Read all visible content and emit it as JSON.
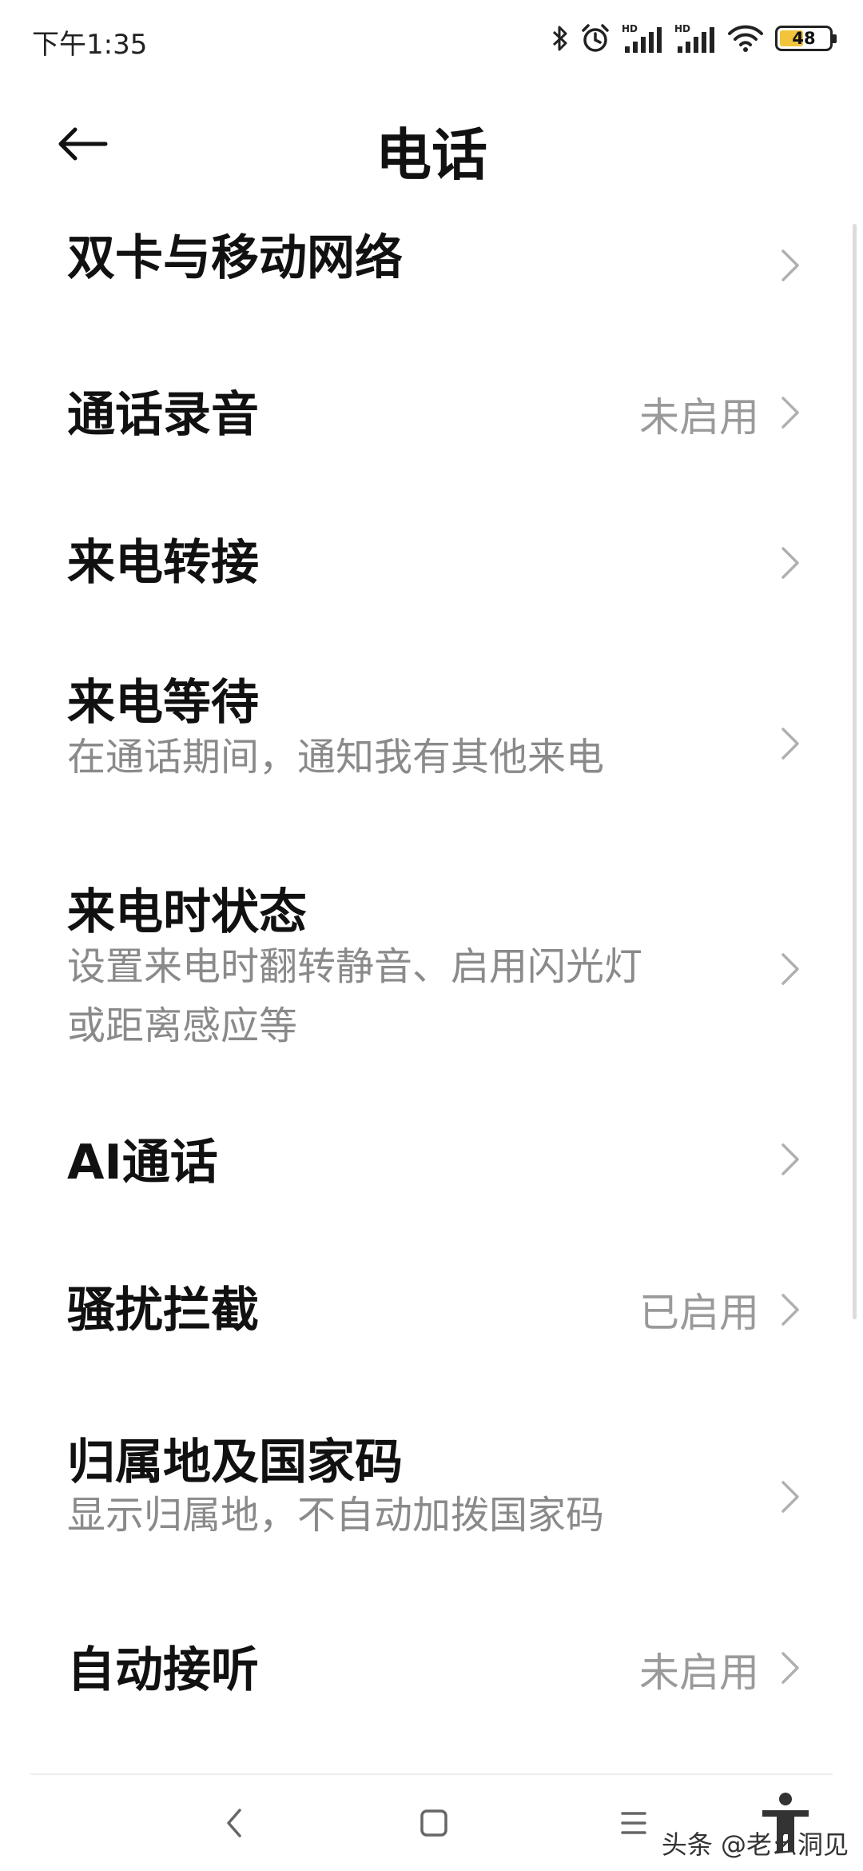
{
  "status_bar": {
    "time": "下午1:35",
    "battery_level": "48",
    "icons": [
      "bluetooth-icon",
      "alarm-icon",
      "hd-signal-icon",
      "hd-signal-icon",
      "wifi-icon",
      "battery-icon"
    ]
  },
  "header": {
    "title": "电话",
    "back_icon": "arrow-left-icon"
  },
  "settings": [
    {
      "title": "双卡与移动网络",
      "subtitle": "",
      "value": ""
    },
    {
      "title": "通话录音",
      "subtitle": "",
      "value": "未启用"
    },
    {
      "title": "来电转接",
      "subtitle": "",
      "value": ""
    },
    {
      "title": "来电等待",
      "subtitle": "在通话期间，通知我有其他来电",
      "value": ""
    },
    {
      "title": "来电时状态",
      "subtitle_line1": "设置来电时翻转静音、启用闪光灯",
      "subtitle_line2": "或距离感应等",
      "value": ""
    },
    {
      "title": "AI通话",
      "subtitle": "",
      "value": ""
    },
    {
      "title": "骚扰拦截",
      "subtitle": "",
      "value": "已启用"
    },
    {
      "title": "归属地及国家码",
      "subtitle": "显示归属地，不自动加拨国家码",
      "value": ""
    },
    {
      "title": "自动接听",
      "subtitle": "",
      "value": "未启用"
    }
  ],
  "nav_bar": {
    "icons": [
      "back-nav-icon",
      "home-nav-icon",
      "menu-nav-icon",
      "accessibility-icon"
    ]
  },
  "watermark": "头条 @老幺洞见",
  "colors": {
    "background": "#ffffff",
    "title": "#111111",
    "subtitle": "#8a8a8a",
    "value": "#9a9a9a",
    "battery_fill": "#f2c43a"
  }
}
